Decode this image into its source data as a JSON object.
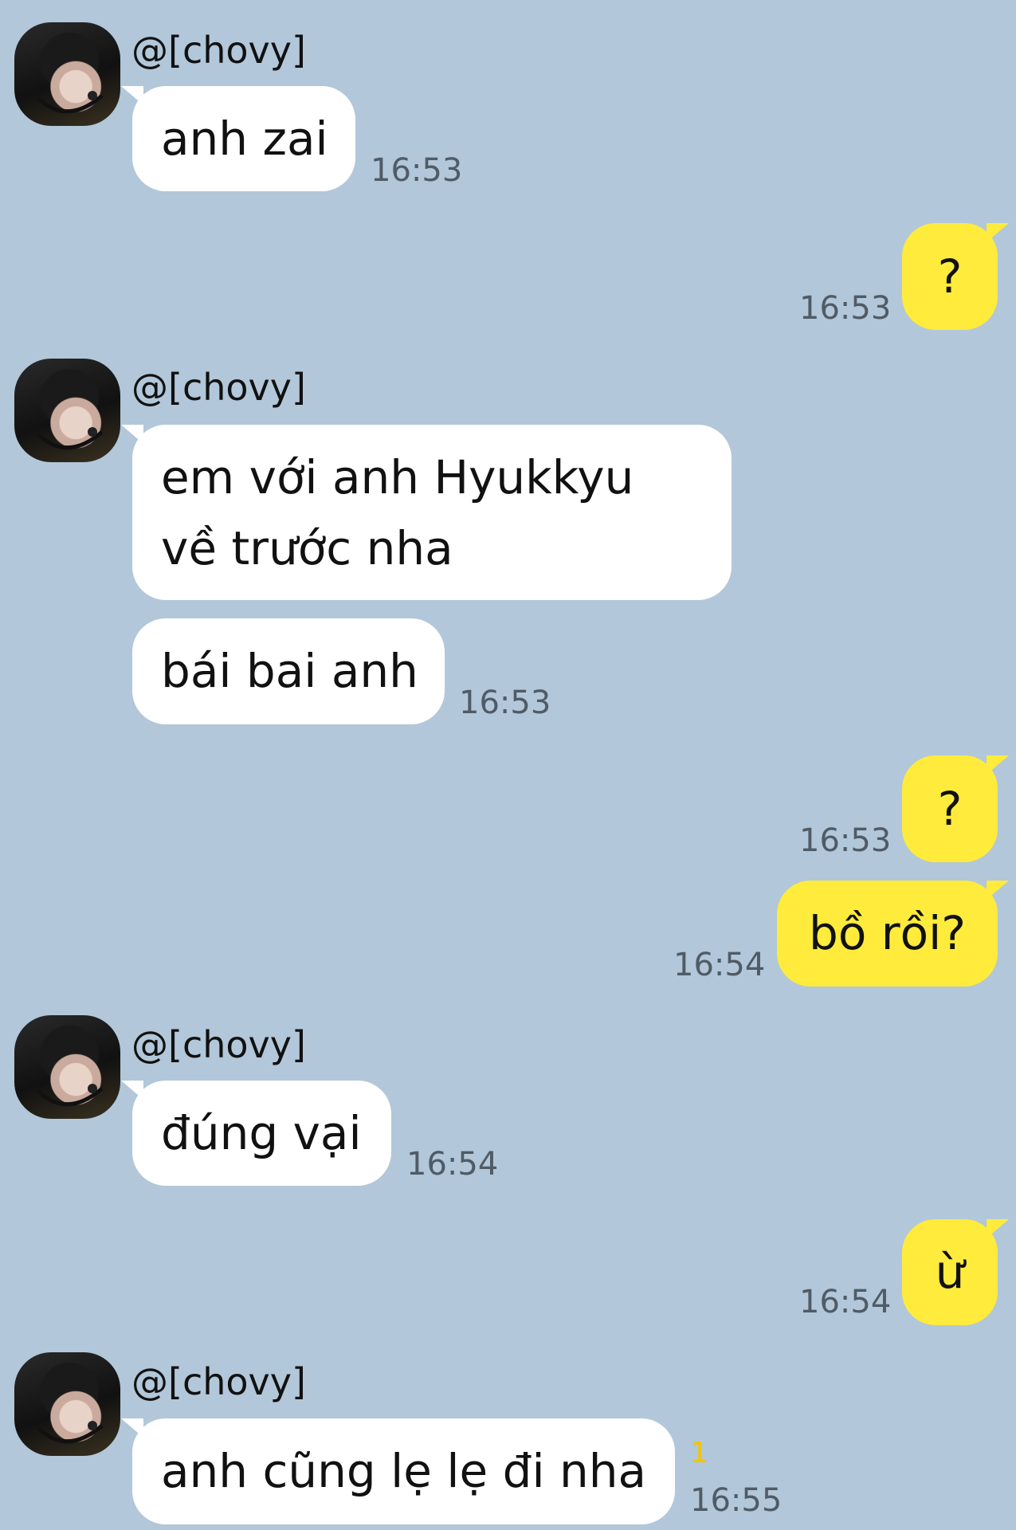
{
  "chat": {
    "sender_name": "@[chovy]",
    "avatar_icon": "profile-avatar",
    "colors": {
      "background": "#b2c7d9",
      "incoming_bubble": "#ffffff",
      "outgoing_bubble": "#ffeb3b",
      "timestamp": "#4f5b66",
      "unread_badge": "#f2c500"
    },
    "messages": [
      {
        "from": "chovy",
        "text": "anh zai",
        "time": "16:53"
      },
      {
        "from": "me",
        "text": "?",
        "time": "16:53"
      },
      {
        "from": "chovy",
        "line1": "em với anh Hyukkyu",
        "line2": "về trước nha"
      },
      {
        "from": "chovy",
        "text": "bái bai anh",
        "time": "16:53"
      },
      {
        "from": "me",
        "text": "?",
        "time": "16:53"
      },
      {
        "from": "me",
        "text": "bồ rồi?",
        "time": "16:54"
      },
      {
        "from": "chovy",
        "text": "đúng vại",
        "time": "16:54"
      },
      {
        "from": "me",
        "text": "ừ",
        "time": "16:54"
      },
      {
        "from": "chovy",
        "text": "anh cũng lẹ lẹ đi nha",
        "time": "16:55",
        "unread": "1"
      }
    ]
  }
}
